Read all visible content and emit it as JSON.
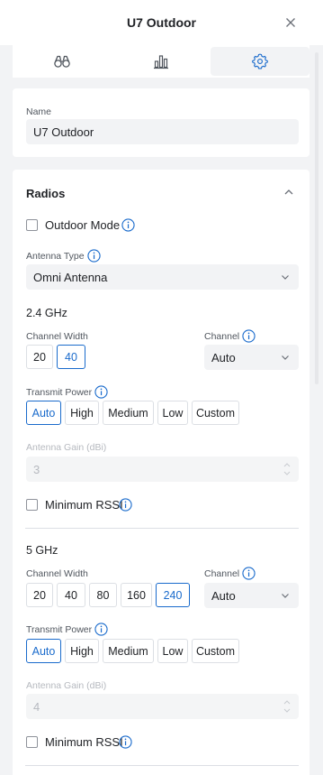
{
  "header": {
    "title": "U7 Outdoor"
  },
  "tabs": [
    {
      "icon": "binoculars-icon"
    },
    {
      "icon": "bar-chart-icon"
    },
    {
      "icon": "gear-icon",
      "active": true
    }
  ],
  "name_section": {
    "label": "Name",
    "value": "U7 Outdoor"
  },
  "radios": {
    "title": "Radios",
    "outdoor_mode_label": "Outdoor Mode",
    "antenna_type": {
      "label": "Antenna Type",
      "value": "Omni Antenna"
    },
    "band_24": {
      "title": "2.4 GHz",
      "channel_width": {
        "label": "Channel Width",
        "options": [
          "20",
          "40"
        ],
        "selected": "40"
      },
      "channel": {
        "label": "Channel",
        "value": "Auto"
      },
      "transmit_power": {
        "label": "Transmit Power",
        "options": [
          "Auto",
          "High",
          "Medium",
          "Low",
          "Custom"
        ],
        "selected": "Auto"
      },
      "antenna_gain": {
        "label": "Antenna Gain (dBi)",
        "value": "3"
      },
      "min_rssi_label": "Minimum RSSI"
    },
    "band_5": {
      "title": "5 GHz",
      "channel_width": {
        "label": "Channel Width",
        "options": [
          "20",
          "40",
          "80",
          "160",
          "240"
        ],
        "selected": "240"
      },
      "channel": {
        "label": "Channel",
        "value": "Auto"
      },
      "transmit_power": {
        "label": "Transmit Power",
        "options": [
          "Auto",
          "High",
          "Medium",
          "Low",
          "Custom"
        ],
        "selected": "Auto"
      },
      "antenna_gain": {
        "label": "Antenna Gain (dBi)",
        "value": "4"
      },
      "min_rssi_label": "Minimum RSSI"
    }
  },
  "colors": {
    "accent": "#1a6bcc",
    "background": "#f2f3f5",
    "card": "#ffffff"
  }
}
